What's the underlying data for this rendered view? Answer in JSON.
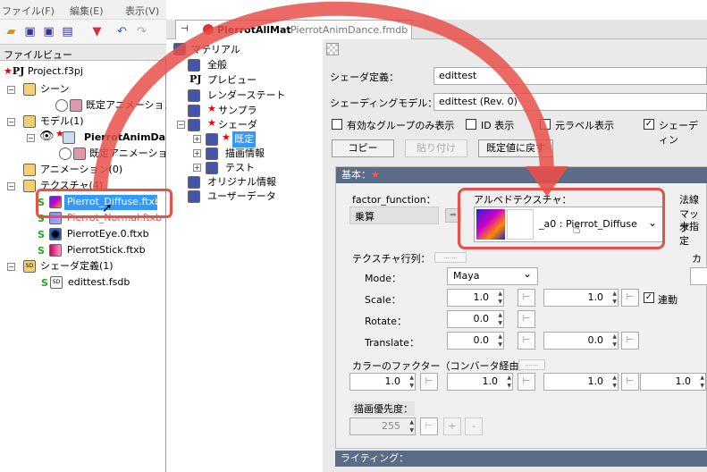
{
  "menu": {
    "items": [
      "ファイル(F)",
      "編集(E)",
      "表示(V)"
    ]
  },
  "file_view": {
    "title": "ファイルビュー",
    "project": "Project.f3pj",
    "scene": "シーン",
    "scene_child": "既定アニメーションセ",
    "model": "モデル(1)",
    "model_child": "PierrotAnimDan",
    "model_anim": "既定アニメーショ",
    "animation": "アニメーション(0)",
    "texture": "テクスチャ(4)",
    "textures": [
      "Pierrot_Diffuse.ftxb",
      "Pierrot_Normal.ftxb",
      "PierrotEye.0.ftxb",
      "PierrotStick.ftxb"
    ],
    "shader_def": "シェーダ定義(1)",
    "shader_file": "edittest.fsdb"
  },
  "tab": {
    "title": "PierrotAllMat",
    "file": "PierrotAnimDance.fmdb"
  },
  "mat_tree": {
    "root": "マテリアル",
    "items": [
      "全般",
      "プレビュー",
      "レンダーステート",
      "サンプラ",
      "シェーダ",
      "既定",
      "描画情報",
      "テスト",
      "オリジナル情報",
      "ユーザーデータ"
    ]
  },
  "props": {
    "shader_def_label": "シェーダ定義：",
    "shader_def_value": "edittest",
    "shading_label": "シェーディングモデル：",
    "shading_value": "edittest (Rev. 0)",
    "cb_valid_groups": "有効なグループのみ表示",
    "cb_id": "ID 表示",
    "cb_raw_label": "元ラベル表示",
    "cb_shading": "シェーディン",
    "btn_copy": "コピー",
    "btn_paste": "貼り付け",
    "btn_reset": "既定値に戻す"
  },
  "basic": {
    "title": "基本：",
    "factor_label": "factor_function：",
    "factor_value": "乗算",
    "albedo_label": "アルベドテクスチャ：",
    "albedo_value": "_a0 : Pierrot_Diffuse",
    "normal_label": "法線マップ",
    "normal_value": "未指定",
    "tex_matrix_label": "テクスチャ行列：",
    "color_label_right": "カラ",
    "mode_label": "Mode：",
    "mode_value": "Maya",
    "scale_label": "Scale：",
    "scale_x": "1.0",
    "scale_y": "1.0",
    "link_label": "連動",
    "rotate_label": "Rotate：",
    "rotate_value": "0.0",
    "translate_label": "Translate：",
    "translate_x": "0.0",
    "translate_y": "0.0",
    "color_factor_label": "カラーのファクター（コンバータ経由）：",
    "color_factors": [
      "1.0",
      "1.0",
      "1.0",
      "1.0"
    ],
    "priority_label": "描画優先度：",
    "priority_value": "255",
    "plus": "+",
    "minus": "-"
  },
  "lighting": {
    "title": "ライティング："
  },
  "colors": {
    "accent": "#e8504a",
    "header": "#5a6c86",
    "selection": "#3399ff"
  }
}
